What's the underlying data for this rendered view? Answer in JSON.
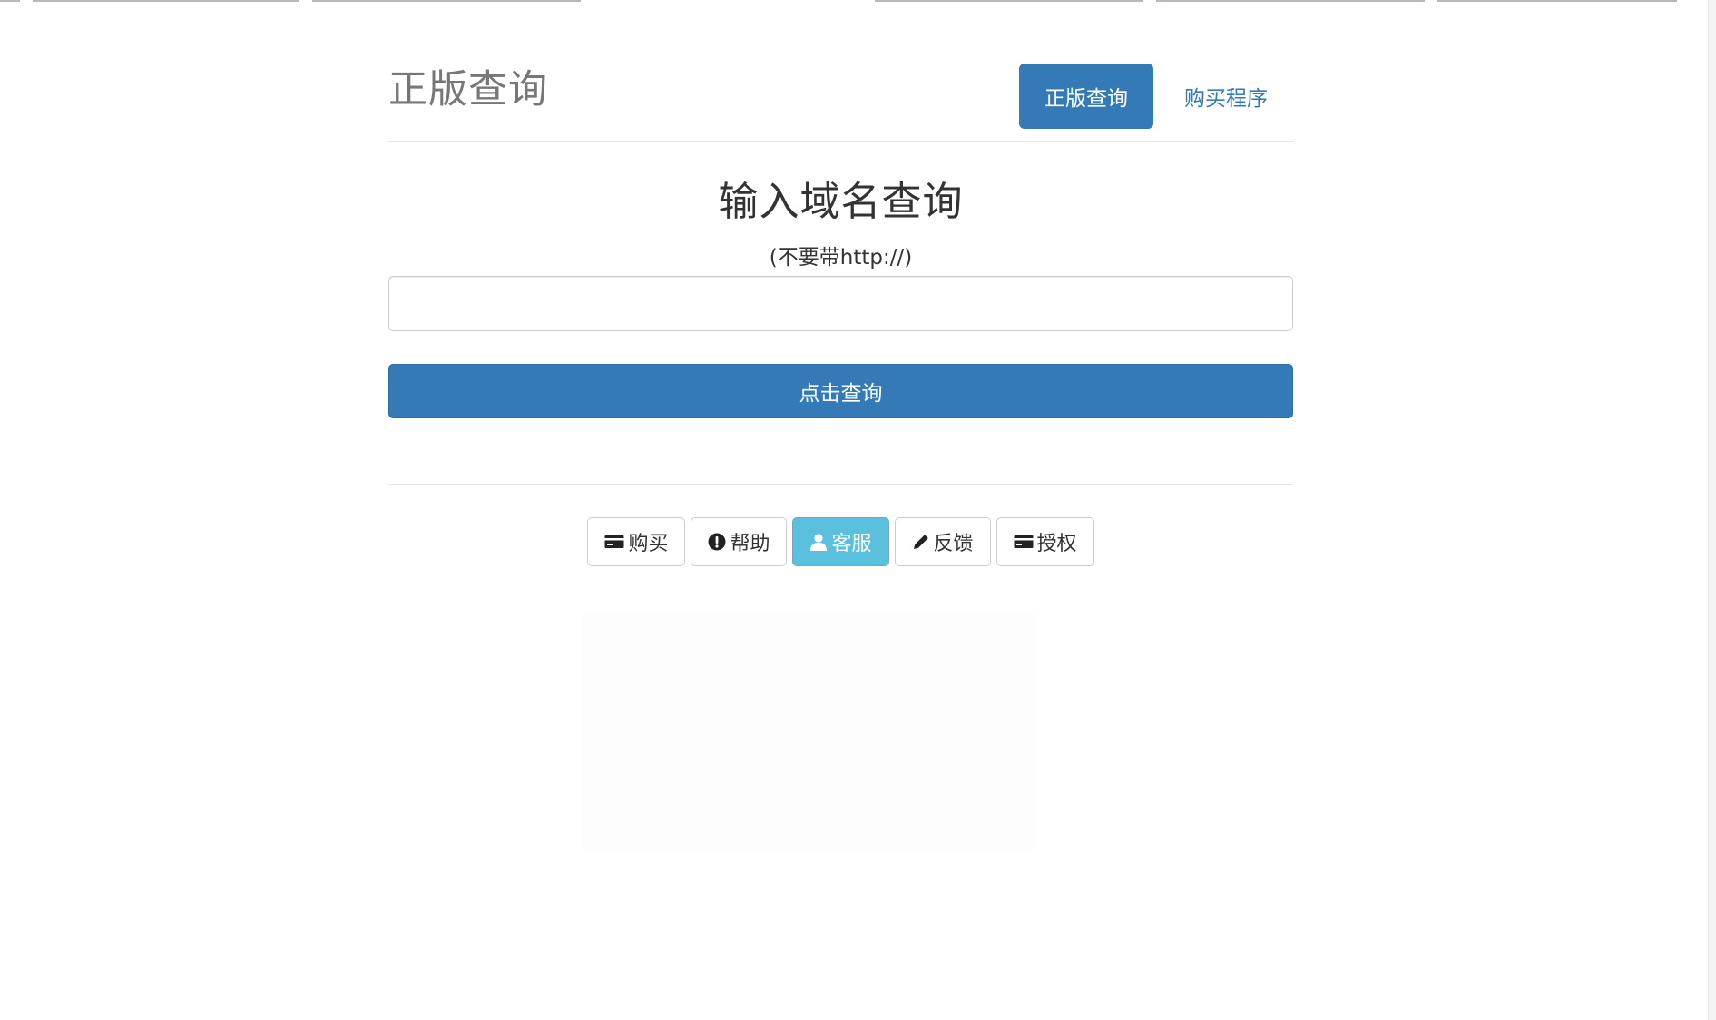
{
  "header": {
    "brand": "正版查询",
    "nav": [
      {
        "label": "正版查询",
        "active": true
      },
      {
        "label": "购买程序",
        "active": false
      }
    ]
  },
  "main": {
    "title": "输入域名查询",
    "hint": "(不要带http://)",
    "input_value": "",
    "submit_label": "点击查询"
  },
  "footer": {
    "buttons": [
      {
        "label": "购买",
        "icon": "credit-card-icon",
        "style": "default"
      },
      {
        "label": "帮助",
        "icon": "exclamation-circle-icon",
        "style": "default"
      },
      {
        "label": "客服",
        "icon": "user-icon",
        "style": "info"
      },
      {
        "label": "反馈",
        "icon": "pencil-icon",
        "style": "default"
      },
      {
        "label": "授权",
        "icon": "credit-card-icon",
        "style": "default"
      }
    ]
  },
  "colors": {
    "primary": "#337ab7",
    "info": "#5bc0de",
    "muted_text": "#777777"
  }
}
